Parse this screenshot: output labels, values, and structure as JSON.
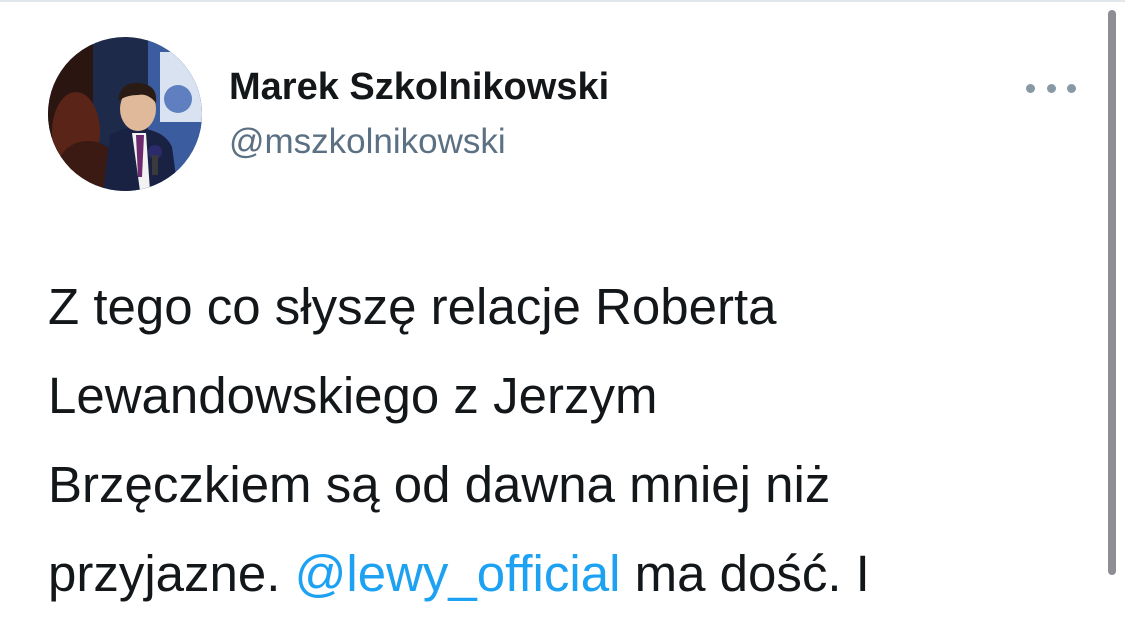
{
  "author": {
    "display_name": "Marek Szkolnikowski",
    "handle": "@mszkolnikowski",
    "avatar_icon": "profile-photo"
  },
  "menu": {
    "icon": "more-horizontal-icon"
  },
  "tweet": {
    "line1": "Z tego co słyszę relacje Roberta",
    "line2": "Lewandowskiego z Jerzym",
    "line3": "Brzęczkiem są od dawna mniej niż",
    "line4_before": "przyjazne. ",
    "mention": "@lewy_official",
    "line4_after": " ma dość. I"
  },
  "colors": {
    "text": "#14171a",
    "secondary": "#5b7083",
    "link": "#1da1f2"
  }
}
